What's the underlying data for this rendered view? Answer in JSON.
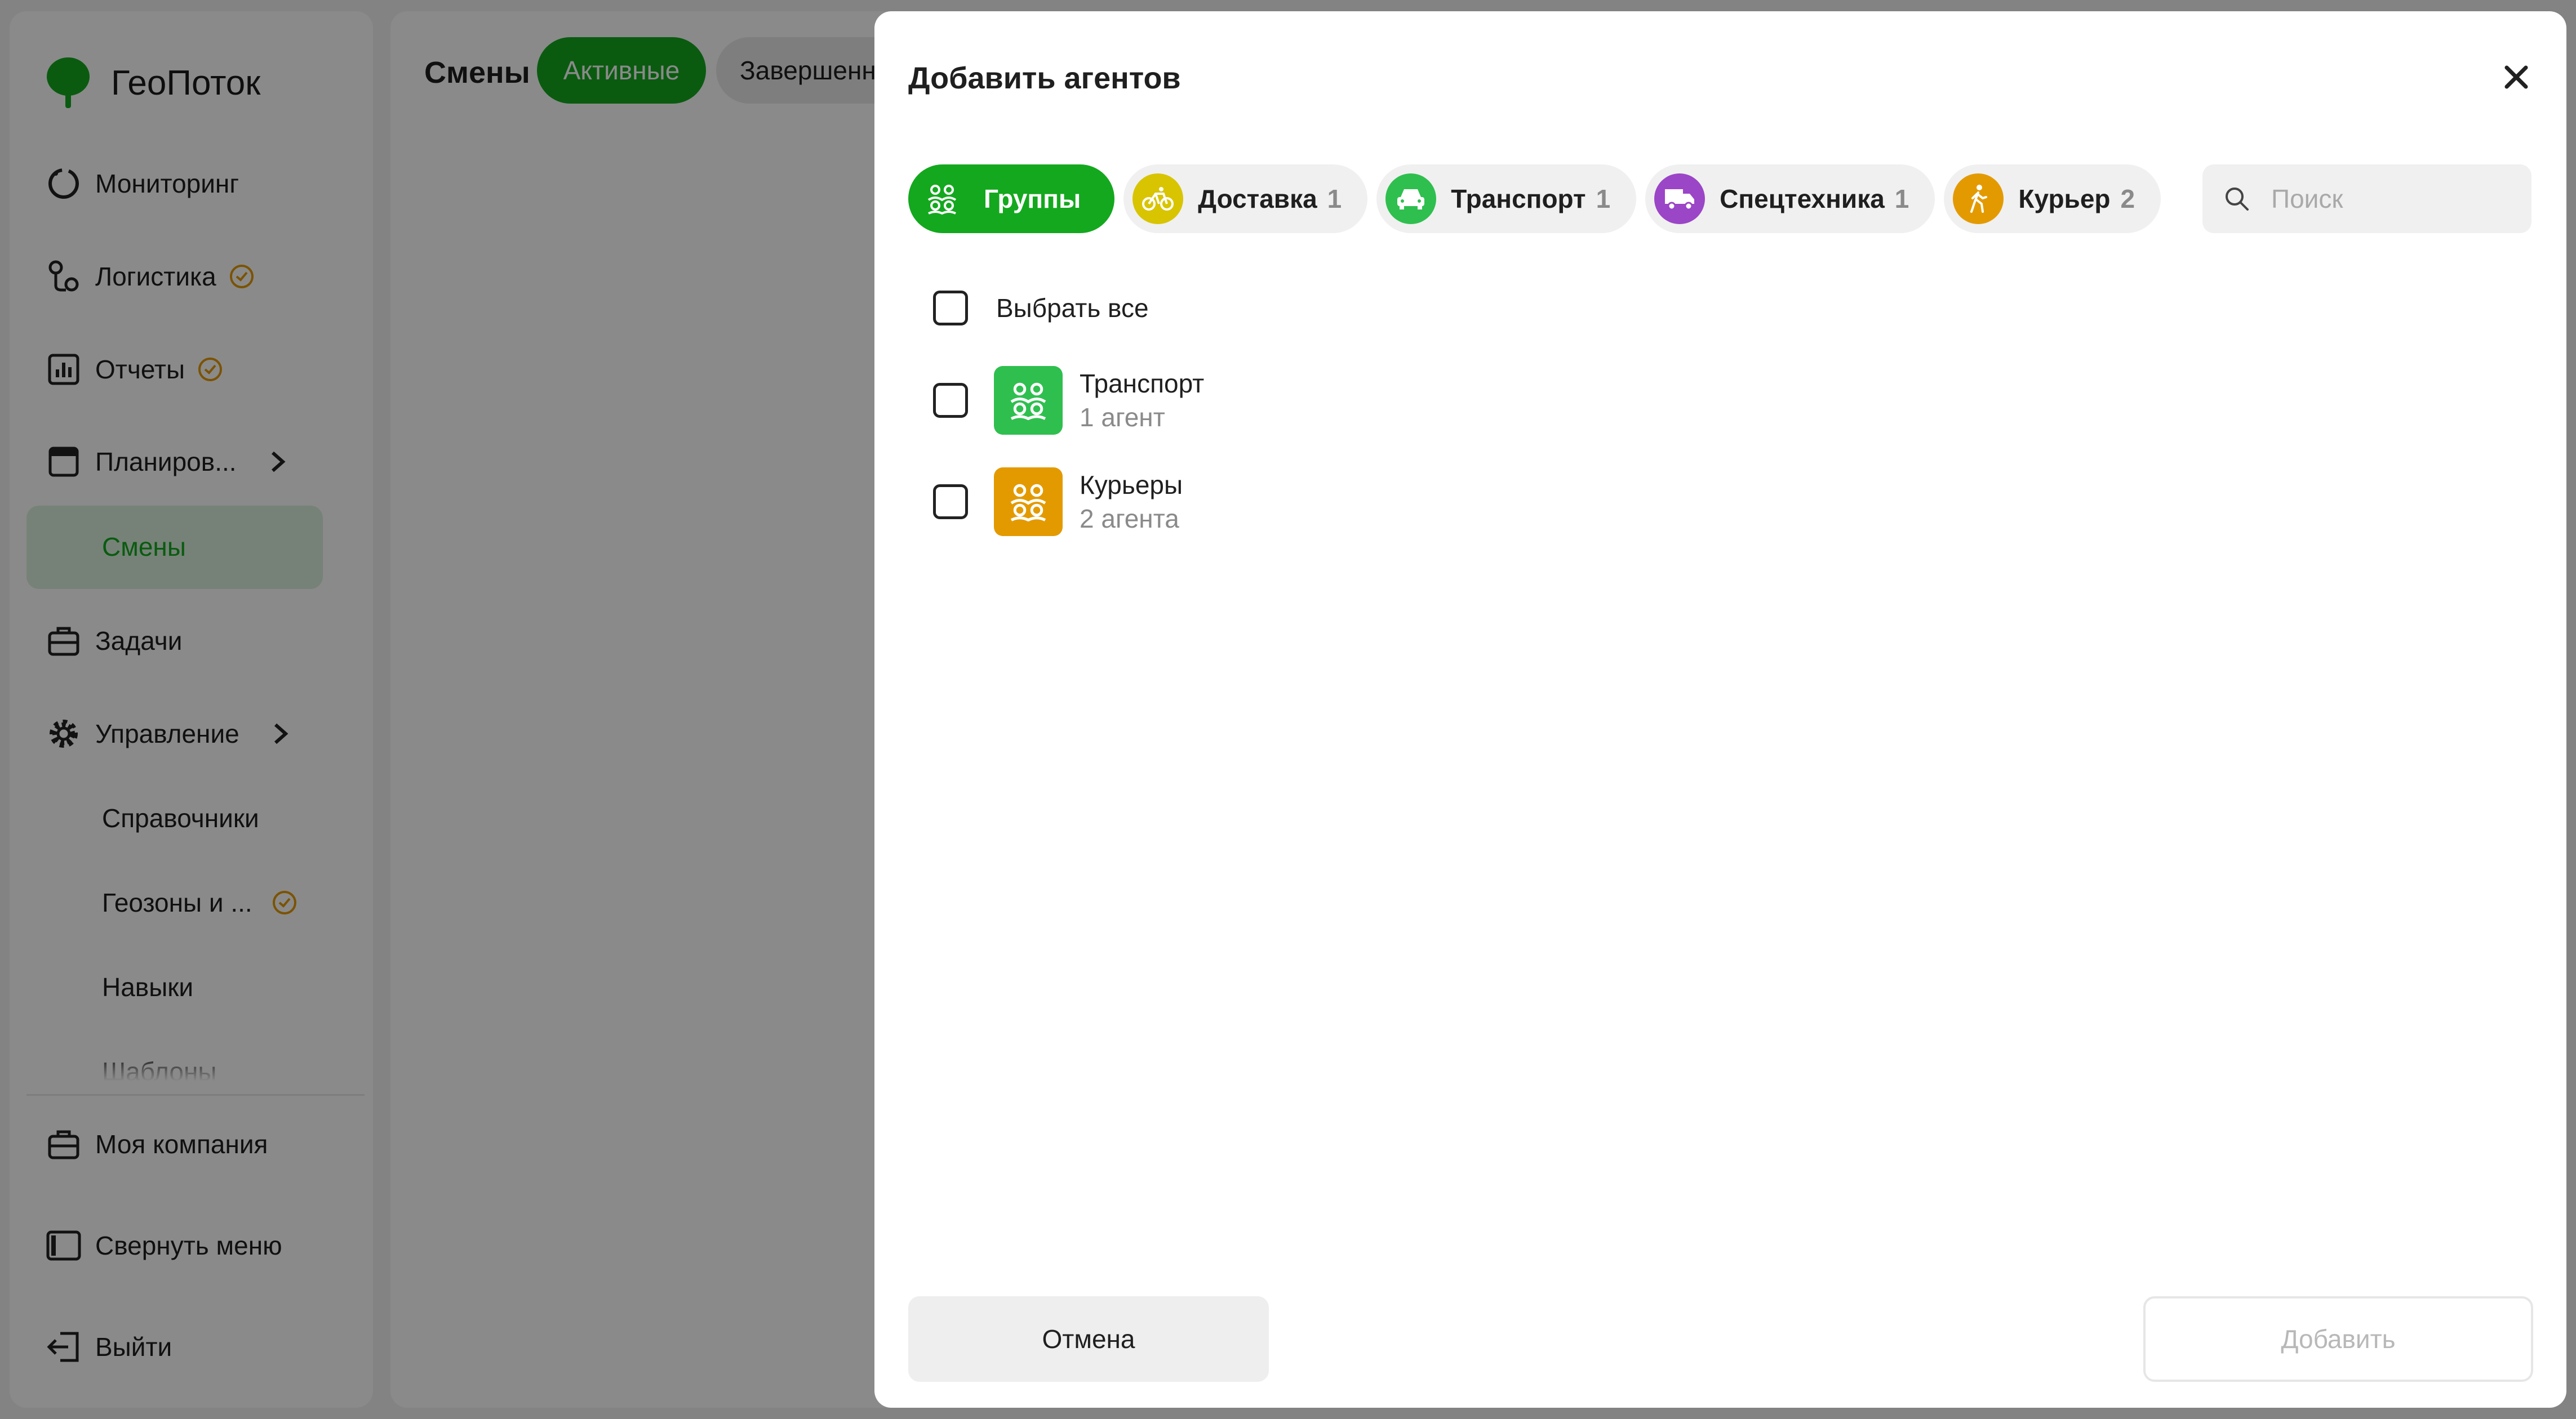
{
  "app": {
    "name": "ГеоПоток"
  },
  "sidebar": {
    "items": [
      {
        "label": "Мониторинг",
        "icon": "monitoring-icon"
      },
      {
        "label": "Логистика",
        "icon": "logistics-icon",
        "badge": "clock-badge-icon"
      },
      {
        "label": "Отчеты",
        "icon": "reports-icon",
        "badge": "clock-badge-icon"
      },
      {
        "label": "Планиров...",
        "icon": "calendar-icon",
        "expandable": true
      },
      {
        "label": "Смены",
        "active": true
      },
      {
        "label": "Задачи",
        "icon": "briefcase-icon"
      },
      {
        "label": "Управление",
        "icon": "gear-icon",
        "expandable": true
      },
      {
        "label": "Справочники"
      },
      {
        "label": "Геозоны и ...",
        "badge": "clock-badge-icon"
      },
      {
        "label": "Навыки"
      },
      {
        "label": "Шаблоны"
      }
    ],
    "bottom": [
      {
        "label": "Моя компания",
        "icon": "briefcase-icon"
      },
      {
        "label": "Свернуть меню",
        "icon": "collapse-menu-icon"
      },
      {
        "label": "Выйти",
        "icon": "logout-icon"
      }
    ]
  },
  "main": {
    "title": "Смены",
    "tabs": [
      {
        "label": "Активные",
        "active": true
      },
      {
        "label": "Завершенные"
      }
    ]
  },
  "modal": {
    "title": "Добавить агентов",
    "tabs": [
      {
        "label": "Группы",
        "selected": true,
        "icon": "group-icon"
      },
      {
        "label": "Доставка",
        "count": "1",
        "icon": "bicycle-icon",
        "color": "#d8c400"
      },
      {
        "label": "Транспорт",
        "count": "1",
        "icon": "car-icon",
        "color": "#2fbf4f"
      },
      {
        "label": "Спецтехника",
        "count": "1",
        "icon": "truck-icon",
        "color": "#9b45c7"
      },
      {
        "label": "Курьер",
        "count": "2",
        "icon": "walking-person-icon",
        "color": "#e39a00"
      }
    ],
    "search": {
      "placeholder": "Поиск",
      "value": ""
    },
    "select_all": "Выбрать все",
    "groups": [
      {
        "name": "Транспорт",
        "count": "1 агент",
        "color": "#2fbf4f",
        "checked": false
      },
      {
        "name": "Курьеры",
        "count": "2 агента",
        "color": "#e39a00",
        "checked": false
      }
    ],
    "cancel_label": "Отмена",
    "add_label": "Добавить"
  },
  "colors": {
    "accent": "#14a81e",
    "active_bg": "#dbf0dc",
    "badge": "#e39a00"
  }
}
